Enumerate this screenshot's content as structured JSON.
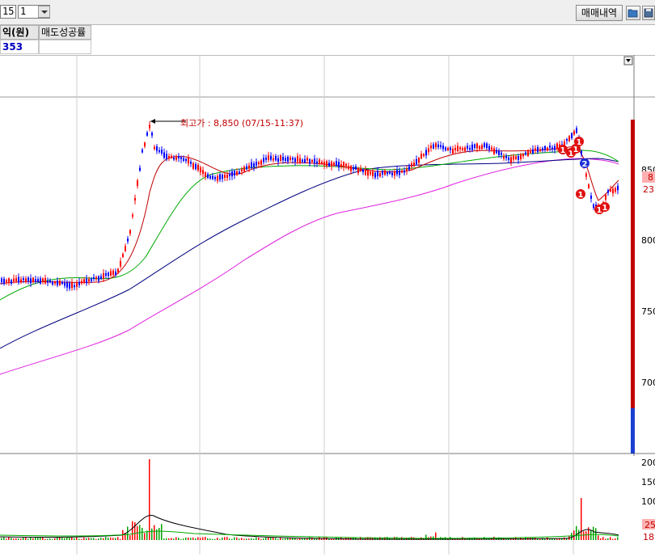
{
  "toolbar": {
    "period_value": "15",
    "count_value": "1",
    "trade_history_label": "매매내역",
    "open_icon": "folder-open-icon",
    "save_icon": "floppy-disk-icon"
  },
  "summary_table": {
    "col1_header": "익(원)",
    "col2_header": "매도성공률",
    "col1_value": "353",
    "col2_value": ""
  },
  "chart": {
    "high_annotation": "최고가 : 8,850 (07/15-11:37)",
    "price_ticks": [
      "850",
      "800",
      "750",
      "700"
    ],
    "volume_ticks": [
      "200",
      "150",
      "100"
    ],
    "current_price_box": "8",
    "current_change": "23",
    "volume_current_box": "25",
    "volume_small_label": "18",
    "signal_numbers": [
      "1",
      "2"
    ]
  },
  "colors": {
    "up_candle": "#ff0000",
    "down_candle": "#0000ff",
    "ma5": "#c00000",
    "ma20": "#00aa00",
    "ma60": "#000080",
    "ma120": "#e020e0"
  }
}
